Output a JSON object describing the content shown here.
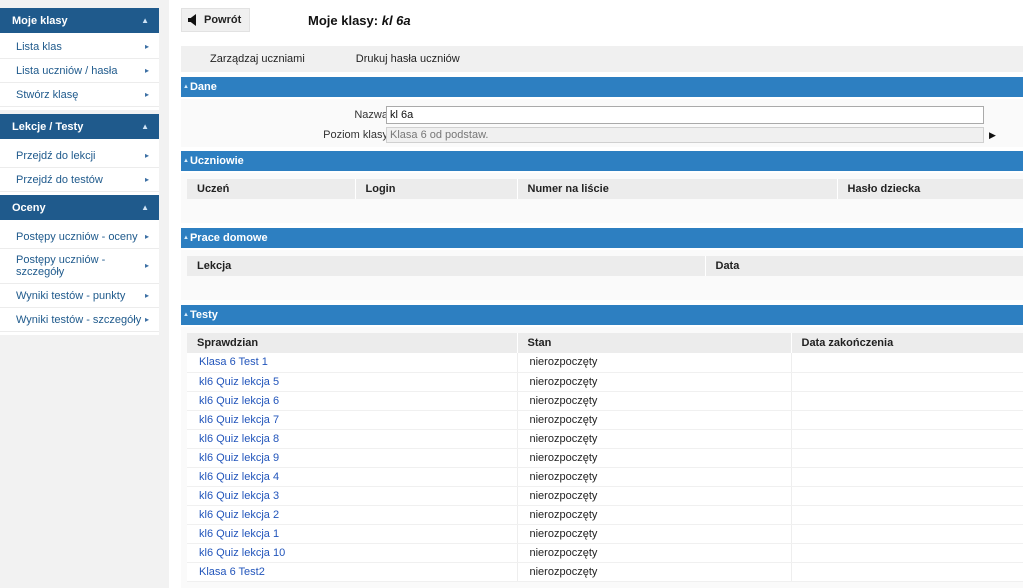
{
  "sidebar": {
    "panels": [
      {
        "title": "Moje klasy",
        "items": [
          "Lista klas",
          "Lista uczniów / hasła",
          "Stwórz klasę"
        ]
      },
      {
        "title": "Lekcje / Testy",
        "items": [
          "Przejdź do lekcji",
          "Przejdź do testów"
        ]
      },
      {
        "title": "Oceny",
        "items": [
          "Postępy uczniów - oceny",
          "Postępy uczniów - szczegóły",
          "Wyniki testów - punkty",
          "Wyniki testów - szczegóły"
        ]
      }
    ]
  },
  "header": {
    "back_label": "Powrót",
    "title_prefix": "Moje klasy:",
    "title_class": "kl 6a"
  },
  "actions": {
    "manage_students": "Zarządzaj uczniami",
    "print_passwords": "Drukuj hasła uczniów"
  },
  "sections": {
    "dane": {
      "title": "Dane",
      "name_label": "Nazwa:",
      "name_value": "kl 6a",
      "level_label": "Poziom klasy:",
      "level_value": "Klasa 6 od podstaw."
    },
    "uczniowie": {
      "title": "Uczniowie",
      "columns": [
        "Uczeń",
        "Login",
        "Numer na liście",
        "Hasło dziecka"
      ]
    },
    "prace": {
      "title": "Prace domowe",
      "columns": [
        "Lekcja",
        "Data"
      ]
    },
    "testy": {
      "title": "Testy",
      "columns": [
        "Sprawdzian",
        "Stan",
        "Data zakończenia"
      ],
      "rows": [
        [
          "Klasa 6 Test 1",
          "nierozpoczęty",
          ""
        ],
        [
          "kl6 Quiz lekcja 5",
          "nierozpoczęty",
          ""
        ],
        [
          "kl6 Quiz lekcja 6",
          "nierozpoczęty",
          ""
        ],
        [
          "kl6 Quiz lekcja 7",
          "nierozpoczęty",
          ""
        ],
        [
          "kl6 Quiz lekcja 8",
          "nierozpoczęty",
          ""
        ],
        [
          "kl6 Quiz lekcja 9",
          "nierozpoczęty",
          ""
        ],
        [
          "kl6 Quiz lekcja 4",
          "nierozpoczęty",
          ""
        ],
        [
          "kl6 Quiz lekcja 3",
          "nierozpoczęty",
          ""
        ],
        [
          "kl6 Quiz lekcja 2",
          "nierozpoczęty",
          ""
        ],
        [
          "kl6 Quiz lekcja 1",
          "nierozpoczęty",
          ""
        ],
        [
          "kl6 Quiz lekcja 10",
          "nierozpoczęty",
          ""
        ],
        [
          "Klasa 6 Test2",
          "nierozpoczęty",
          ""
        ]
      ]
    }
  },
  "colors": {
    "sidebar_header": "#1f5a8c",
    "section_header": "#2d7fc1",
    "link": "#2255bb"
  },
  "icons": {
    "collapse": "chevron-up-icon",
    "item": "chevron-right-icon",
    "back": "arrow-left-icon",
    "select": "triangle-right-icon"
  }
}
